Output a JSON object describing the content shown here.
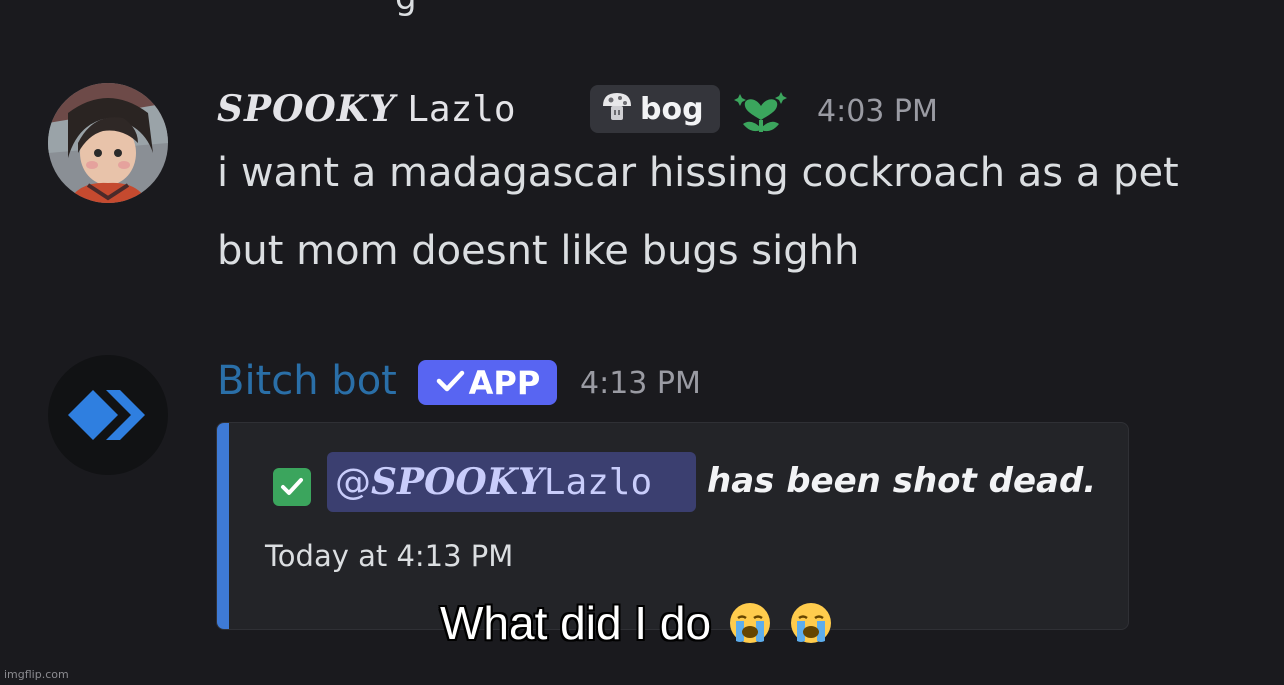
{
  "previous_message_fragment": "g",
  "messages": [
    {
      "author": {
        "styled_name": "𝑺𝑷𝑶𝑶𝑲𝒀",
        "mono_name": "Lazlo"
      },
      "server_tag": {
        "label": "bog",
        "icon": "mushroom-icon"
      },
      "role_icon": "heart-plant-icon",
      "timestamp": "4:03 PM",
      "lines": [
        "i want a madagascar hissing cockroach as a pet",
        "but mom doesnt like bugs sighh"
      ]
    },
    {
      "author": {
        "name": "Bitch bot"
      },
      "badge": {
        "label": "APP",
        "icon": "checkmark-icon"
      },
      "timestamp": "4:13 PM",
      "embed": {
        "status_icon": "check-box-icon",
        "mention": {
          "prefix": "@",
          "styled_name": "𝑺𝑷𝑶𝑶𝑲𝒀",
          "mono_name": "Lazlo"
        },
        "text": "has been shot dead.",
        "footer": "Today at 4:13 PM"
      }
    }
  ],
  "caption": {
    "text": "What did I do",
    "emoji": [
      "loudly-crying-face",
      "loudly-crying-face"
    ]
  },
  "watermark": "imgflip.com",
  "colors": {
    "background": "#1a1a1e",
    "bot_name": "#2a6fa8",
    "app_badge": "#5865f2",
    "embed_bar": "#3e7ad6",
    "mention_bg": "#3b3f70",
    "check_green": "#3ba55d"
  }
}
